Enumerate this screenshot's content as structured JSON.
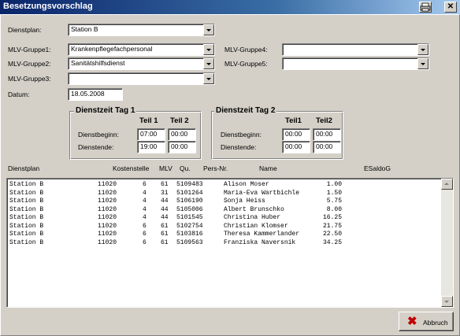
{
  "window": {
    "title": "Besetzungsvorschlag",
    "print_icon": "printer-icon",
    "close_icon": "close-icon",
    "close_glyph": "✕"
  },
  "form": {
    "dienstplan_label": "Dienstplan:",
    "dienstplan_value": "Station B",
    "mlv1_label": "MLV-Gruppe1:",
    "mlv1_value": "Krankenpflegefachpersonal",
    "mlv2_label": "MLV-Gruppe2:",
    "mlv2_value": "Sanitätshilfsdienst",
    "mlv3_label": "MLV-Gruppe3:",
    "mlv3_value": "",
    "mlv4_label": "MLV-Gruppe4:",
    "mlv4_value": "",
    "mlv5_label": "MLV-Gruppe5:",
    "mlv5_value": "",
    "datum_label": "Datum:",
    "datum_value": "18.05.2008"
  },
  "tag1": {
    "title": "Dienstzeit Tag 1",
    "teil1": "Teil 1",
    "teil2": "Teil 2",
    "beginn_label": "Dienstbeginn:",
    "ende_label": "Dienstende:",
    "beginn1": "07:00",
    "beginn2": "00:00",
    "ende1": "19:00",
    "ende2": "00:00"
  },
  "tag2": {
    "title": "Dienstzeit Tag 2",
    "teil1": "Teil1",
    "teil2": "Teil2",
    "beginn_label": "Dienstbeginn:",
    "ende_label": "Dienstende:",
    "beginn1": "00:00",
    "beginn2": "00:00",
    "ende1": "00:00",
    "ende2": "00:00"
  },
  "table": {
    "headers": {
      "dienstplan": "Dienstplan",
      "kostenstelle": "Kostenstelle",
      "mlv": "MLV",
      "qu": "Qu.",
      "persnr": "Pers-Nr.",
      "name": "Name",
      "esaldo": "ESaldoG"
    },
    "rows": [
      {
        "dienstplan": "Station B",
        "kostenstelle": "11020",
        "mlv": "6",
        "qu": "61",
        "persnr": "5109483",
        "name": "Alison Moser",
        "esaldo": "1.00"
      },
      {
        "dienstplan": "Station B",
        "kostenstelle": "11020",
        "mlv": "4",
        "qu": "31",
        "persnr": "5101264",
        "name": "Maria-Eva Wartbichle",
        "esaldo": "1.50"
      },
      {
        "dienstplan": "Station B",
        "kostenstelle": "11020",
        "mlv": "4",
        "qu": "44",
        "persnr": "5106190",
        "name": "Sonja Heiss",
        "esaldo": "5.75"
      },
      {
        "dienstplan": "Station B",
        "kostenstelle": "11020",
        "mlv": "4",
        "qu": "44",
        "persnr": "5105006",
        "name": "Albert Brunschko",
        "esaldo": "8.00"
      },
      {
        "dienstplan": "Station B",
        "kostenstelle": "11020",
        "mlv": "4",
        "qu": "44",
        "persnr": "5101545",
        "name": "Christina Huber",
        "esaldo": "16.25"
      },
      {
        "dienstplan": "Station B",
        "kostenstelle": "11020",
        "mlv": "6",
        "qu": "61",
        "persnr": "5102754",
        "name": "Christian Klomser",
        "esaldo": "21.75"
      },
      {
        "dienstplan": "Station B",
        "kostenstelle": "11020",
        "mlv": "6",
        "qu": "61",
        "persnr": "5103816",
        "name": "Theresa Kammerlander",
        "esaldo": "22.50"
      },
      {
        "dienstplan": "Station B",
        "kostenstelle": "11020",
        "mlv": "6",
        "qu": "61",
        "persnr": "5109563",
        "name": "Franziska Naversnik",
        "esaldo": "34.25"
      }
    ]
  },
  "buttons": {
    "abbruch_label": "Abbruch",
    "abbruch_icon": "x-cancel-icon",
    "abbruch_glyph": "✖"
  },
  "colors": {
    "titlebar_start": "#0a246a",
    "titlebar_end": "#a6caf0",
    "window_bg": "#d4d0c8",
    "cancel_icon": "#c00000"
  }
}
